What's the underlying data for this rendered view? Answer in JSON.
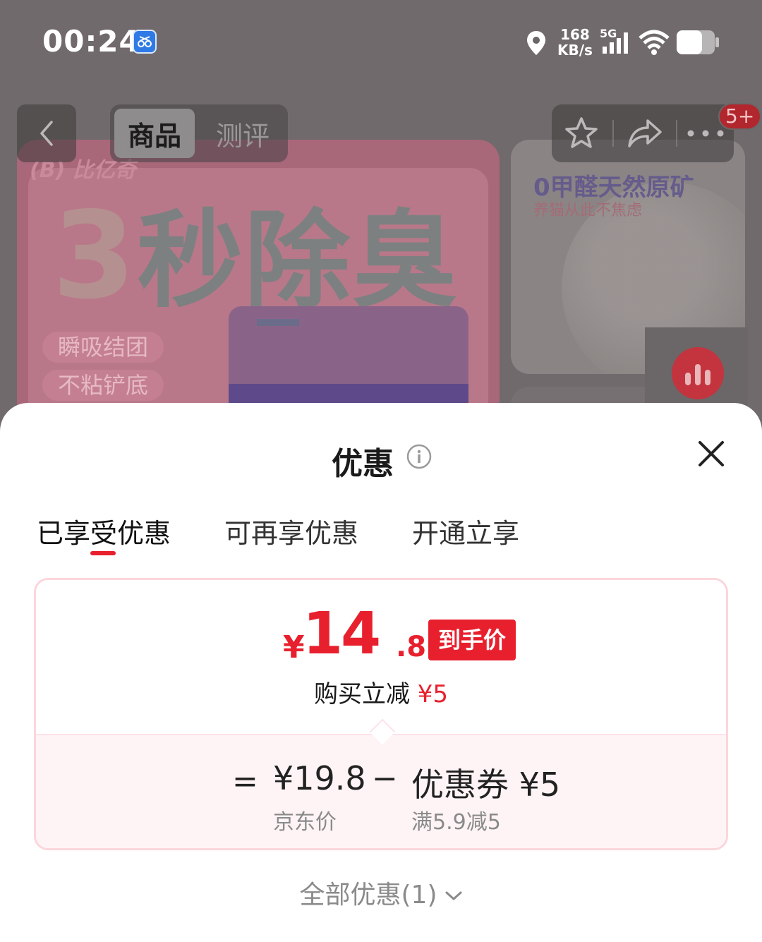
{
  "status_bar": {
    "time": "00:24",
    "speed_value": "168",
    "speed_unit": "KB/s",
    "network": "5G"
  },
  "nav": {
    "tabs": [
      "商品",
      "测评"
    ],
    "active_tab": "商品",
    "badge": "5+"
  },
  "background": {
    "hero_brand": "(B) 比亿奇",
    "hero_headline_digit": "3",
    "hero_headline": "秒除臭",
    "hero_tags": [
      "瞬吸结团",
      "不粘铲底"
    ],
    "side_title": "0甲醛天然原矿",
    "side_subtitle": "养猫从此不焦虑"
  },
  "sheet": {
    "title": "优惠",
    "tabs": [
      "已享受优惠",
      "可再享优惠",
      "开通立享"
    ],
    "active_tab_index": 0,
    "final_price": {
      "currency": "¥",
      "integer": "14",
      "decimal": ".8",
      "tag": "到手价"
    },
    "reduction": {
      "label": "购买立减",
      "amount": "¥5"
    },
    "breakdown": {
      "equals": "=",
      "jd_price": "¥19.8",
      "jd_label": "京东价",
      "minus": "−",
      "coupon": "优惠券 ¥5",
      "coupon_condition": "满5.9减5"
    },
    "all_deals": "全部优惠(1)"
  },
  "colors": {
    "accent": "#e8202e",
    "card_border": "#fbd6dc",
    "card_bottom_bg": "#fff4f5"
  }
}
